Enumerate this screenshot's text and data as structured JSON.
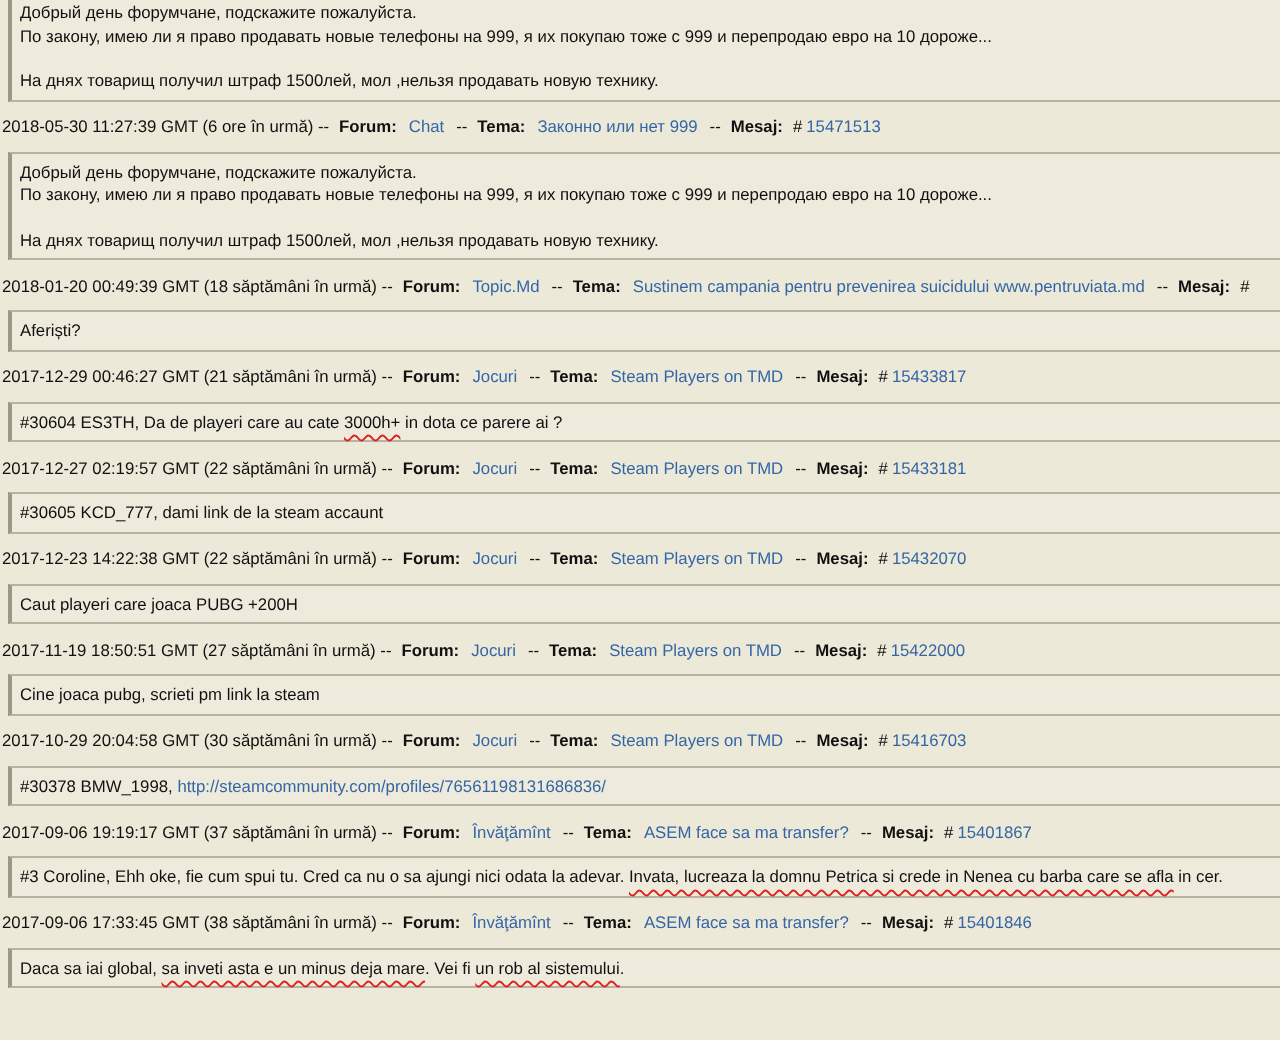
{
  "entries": [
    {
      "kind": "message",
      "paragraphs": [
        [
          [
            {
              "kind": "text",
              "text": "Добрый день форумчане, подскажите пожалуйста."
            }
          ],
          [
            {
              "kind": "text",
              "text": "По закону, имею ли я право продавать новые телефоны на 999, я их покупаю тоже с 999 и перепродаю евро на 10 дороже..."
            }
          ]
        ],
        [
          [
            {
              "kind": "text",
              "text": "На днях товарищ получил штраф 1500лей, мол ,нельзя продавать новую технику."
            }
          ]
        ]
      ]
    },
    {
      "kind": "header",
      "parts": [
        {
          "kind": "date",
          "text": "2018-05-30 11:27:39 GMT (6 ore în urmă) --"
        },
        {
          "kind": "label",
          "text": "Forum:"
        },
        {
          "kind": "forum",
          "text": "Chat"
        },
        {
          "kind": "sep",
          "text": "--"
        },
        {
          "kind": "label",
          "text": "Tema:"
        },
        {
          "kind": "topic",
          "text": "Законно или нет 999"
        },
        {
          "kind": "sep",
          "text": "--"
        },
        {
          "kind": "label",
          "text": "Mesaj:"
        },
        {
          "kind": "hash",
          "text": "#"
        },
        {
          "kind": "message",
          "text": "15471513"
        }
      ]
    },
    {
      "kind": "message",
      "paragraphs": [
        [
          [
            {
              "kind": "text",
              "text": "Добрый день форумчане, подскажите пожалуйста."
            }
          ],
          [
            {
              "kind": "text",
              "text": "По закону, имею ли я право продавать новые телефоны на 999, я их покупаю тоже с 999 и перепродаю евро на 10 дороже..."
            }
          ]
        ],
        [
          [
            {
              "kind": "text",
              "text": "На днях товарищ получил штраф 1500лей, мол ,нельзя продавать новую технику."
            }
          ]
        ]
      ]
    },
    {
      "kind": "header",
      "parts": [
        {
          "kind": "date",
          "text": "2018-01-20 00:49:39 GMT (18 săptămâni în urmă) --"
        },
        {
          "kind": "label",
          "text": "Forum:"
        },
        {
          "kind": "forum",
          "text": "Topic.Md"
        },
        {
          "kind": "sep",
          "text": "--"
        },
        {
          "kind": "label",
          "text": "Tema:"
        },
        {
          "kind": "topic",
          "text": "Sustinem campania pentru prevenirea suicidului www.pentruviata.md"
        },
        {
          "kind": "sep",
          "text": "--"
        },
        {
          "kind": "label",
          "text": "Mesaj:"
        },
        {
          "kind": "hash",
          "text": "#"
        }
      ]
    },
    {
      "kind": "message",
      "paragraphs": [
        [
          [
            {
              "kind": "text",
              "text": "Aferiști?"
            }
          ]
        ]
      ]
    },
    {
      "kind": "header",
      "parts": [
        {
          "kind": "date",
          "text": "2017-12-29 00:46:27 GMT (21 săptămâni în urmă) --"
        },
        {
          "kind": "label",
          "text": "Forum:"
        },
        {
          "kind": "forum",
          "text": "Jocuri"
        },
        {
          "kind": "sep",
          "text": "--"
        },
        {
          "kind": "label",
          "text": "Tema:"
        },
        {
          "kind": "topic",
          "text": "Steam Players on TMD"
        },
        {
          "kind": "sep",
          "text": "--"
        },
        {
          "kind": "label",
          "text": "Mesaj:"
        },
        {
          "kind": "hash",
          "text": "#"
        },
        {
          "kind": "message",
          "text": "15433817"
        }
      ]
    },
    {
      "kind": "message",
      "paragraphs": [
        [
          [
            {
              "kind": "text",
              "text": "#30604 ES3TH, Da de playeri care au cate "
            },
            {
              "kind": "marked",
              "text": "3000h+"
            },
            {
              "kind": "text",
              "text": " in dota ce parere ai ?"
            }
          ]
        ]
      ]
    },
    {
      "kind": "header",
      "parts": [
        {
          "kind": "date",
          "text": "2017-12-27 02:19:57 GMT (22 săptămâni în urmă) --"
        },
        {
          "kind": "label",
          "text": "Forum:"
        },
        {
          "kind": "forum",
          "text": "Jocuri"
        },
        {
          "kind": "sep",
          "text": "--"
        },
        {
          "kind": "label",
          "text": "Tema:"
        },
        {
          "kind": "topic",
          "text": "Steam Players on TMD"
        },
        {
          "kind": "sep",
          "text": "--"
        },
        {
          "kind": "label",
          "text": "Mesaj:"
        },
        {
          "kind": "hash",
          "text": "#"
        },
        {
          "kind": "message",
          "text": "15433181"
        }
      ]
    },
    {
      "kind": "message",
      "paragraphs": [
        [
          [
            {
              "kind": "text",
              "text": "#30605 KCD_777, dami link de la steam accaunt"
            }
          ]
        ]
      ]
    },
    {
      "kind": "header",
      "parts": [
        {
          "kind": "date",
          "text": "2017-12-23 14:22:38 GMT (22 săptămâni în urmă) --"
        },
        {
          "kind": "label",
          "text": "Forum:"
        },
        {
          "kind": "forum",
          "text": "Jocuri"
        },
        {
          "kind": "sep",
          "text": "--"
        },
        {
          "kind": "label",
          "text": "Tema:"
        },
        {
          "kind": "topic",
          "text": "Steam Players on TMD"
        },
        {
          "kind": "sep",
          "text": "--"
        },
        {
          "kind": "label",
          "text": "Mesaj:"
        },
        {
          "kind": "hash",
          "text": "#"
        },
        {
          "kind": "message",
          "text": "15432070"
        }
      ]
    },
    {
      "kind": "message",
      "paragraphs": [
        [
          [
            {
              "kind": "text",
              "text": "Caut playeri care joaca PUBG +200H"
            }
          ]
        ]
      ]
    },
    {
      "kind": "header",
      "parts": [
        {
          "kind": "date",
          "text": "2017-11-19 18:50:51 GMT (27 săptămâni în urmă) --"
        },
        {
          "kind": "label",
          "text": "Forum:"
        },
        {
          "kind": "forum",
          "text": "Jocuri"
        },
        {
          "kind": "sep",
          "text": "--"
        },
        {
          "kind": "label",
          "text": "Tema:"
        },
        {
          "kind": "topic",
          "text": "Steam Players on TMD"
        },
        {
          "kind": "sep",
          "text": "--"
        },
        {
          "kind": "label",
          "text": "Mesaj:"
        },
        {
          "kind": "hash",
          "text": "#"
        },
        {
          "kind": "message",
          "text": "15422000"
        }
      ]
    },
    {
      "kind": "message",
      "paragraphs": [
        [
          [
            {
              "kind": "text",
              "text": "Cine joaca pubg, scrieti pm link la steam"
            }
          ]
        ]
      ]
    },
    {
      "kind": "header",
      "parts": [
        {
          "kind": "date",
          "text": "2017-10-29 20:04:58 GMT (30 săptămâni în urmă) --"
        },
        {
          "kind": "label",
          "text": "Forum:"
        },
        {
          "kind": "forum",
          "text": "Jocuri"
        },
        {
          "kind": "sep",
          "text": "--"
        },
        {
          "kind": "label",
          "text": "Tema:"
        },
        {
          "kind": "topic",
          "text": "Steam Players on TMD"
        },
        {
          "kind": "sep",
          "text": "--"
        },
        {
          "kind": "label",
          "text": "Mesaj:"
        },
        {
          "kind": "hash",
          "text": "#"
        },
        {
          "kind": "message",
          "text": "15416703"
        }
      ]
    },
    {
      "kind": "message",
      "paragraphs": [
        [
          [
            {
              "kind": "text",
              "text": "#30378 BMW_1998, "
            },
            {
              "kind": "link",
              "text": "http://steamcommunity.com/profiles/76561198131686836/"
            }
          ]
        ]
      ]
    },
    {
      "kind": "header",
      "parts": [
        {
          "kind": "date",
          "text": "2017-09-06 19:19:17 GMT (37 săptămâni în urmă) --"
        },
        {
          "kind": "label",
          "text": "Forum:"
        },
        {
          "kind": "forum",
          "text": "Învăţămînt"
        },
        {
          "kind": "sep",
          "text": "--"
        },
        {
          "kind": "label",
          "text": "Tema:"
        },
        {
          "kind": "topic",
          "text": "ASEM face sa ma transfer?"
        },
        {
          "kind": "sep",
          "text": "--"
        },
        {
          "kind": "label",
          "text": "Mesaj:"
        },
        {
          "kind": "hash",
          "text": "#"
        },
        {
          "kind": "message",
          "text": "15401867"
        }
      ]
    },
    {
      "kind": "message",
      "paragraphs": [
        [
          [
            {
              "kind": "text",
              "text": "#3 Coroline, Ehh oke, fie cum spui tu. Cred ca nu o sa ajungi nici odata la adevar. "
            },
            {
              "kind": "marked",
              "text": "Invata, lucreaza la domnu Petrica si crede in Nenea cu barba care se afla"
            },
            {
              "kind": "text",
              "text": " in cer."
            }
          ]
        ]
      ]
    },
    {
      "kind": "header",
      "parts": [
        {
          "kind": "date",
          "text": "2017-09-06 17:33:45 GMT (38 săptămâni în urmă) --"
        },
        {
          "kind": "label",
          "text": "Forum:"
        },
        {
          "kind": "forum",
          "text": "Învăţămînt"
        },
        {
          "kind": "sep",
          "text": "--"
        },
        {
          "kind": "label",
          "text": "Tema:"
        },
        {
          "kind": "topic",
          "text": "ASEM face sa ma transfer?"
        },
        {
          "kind": "sep",
          "text": "--"
        },
        {
          "kind": "label",
          "text": "Mesaj:"
        },
        {
          "kind": "hash",
          "text": "#"
        },
        {
          "kind": "message",
          "text": "15401846"
        }
      ]
    },
    {
      "kind": "message",
      "paragraphs": [
        [
          [
            {
              "kind": "text",
              "text": "Daca sa iai global, "
            },
            {
              "kind": "marked",
              "text": "sa inveti asta e un minus deja mare"
            },
            {
              "kind": "text",
              "text": ". Vei fi "
            },
            {
              "kind": "marked",
              "text": "un rob al sistemului"
            },
            {
              "kind": "text",
              "text": "."
            }
          ]
        ]
      ]
    }
  ]
}
